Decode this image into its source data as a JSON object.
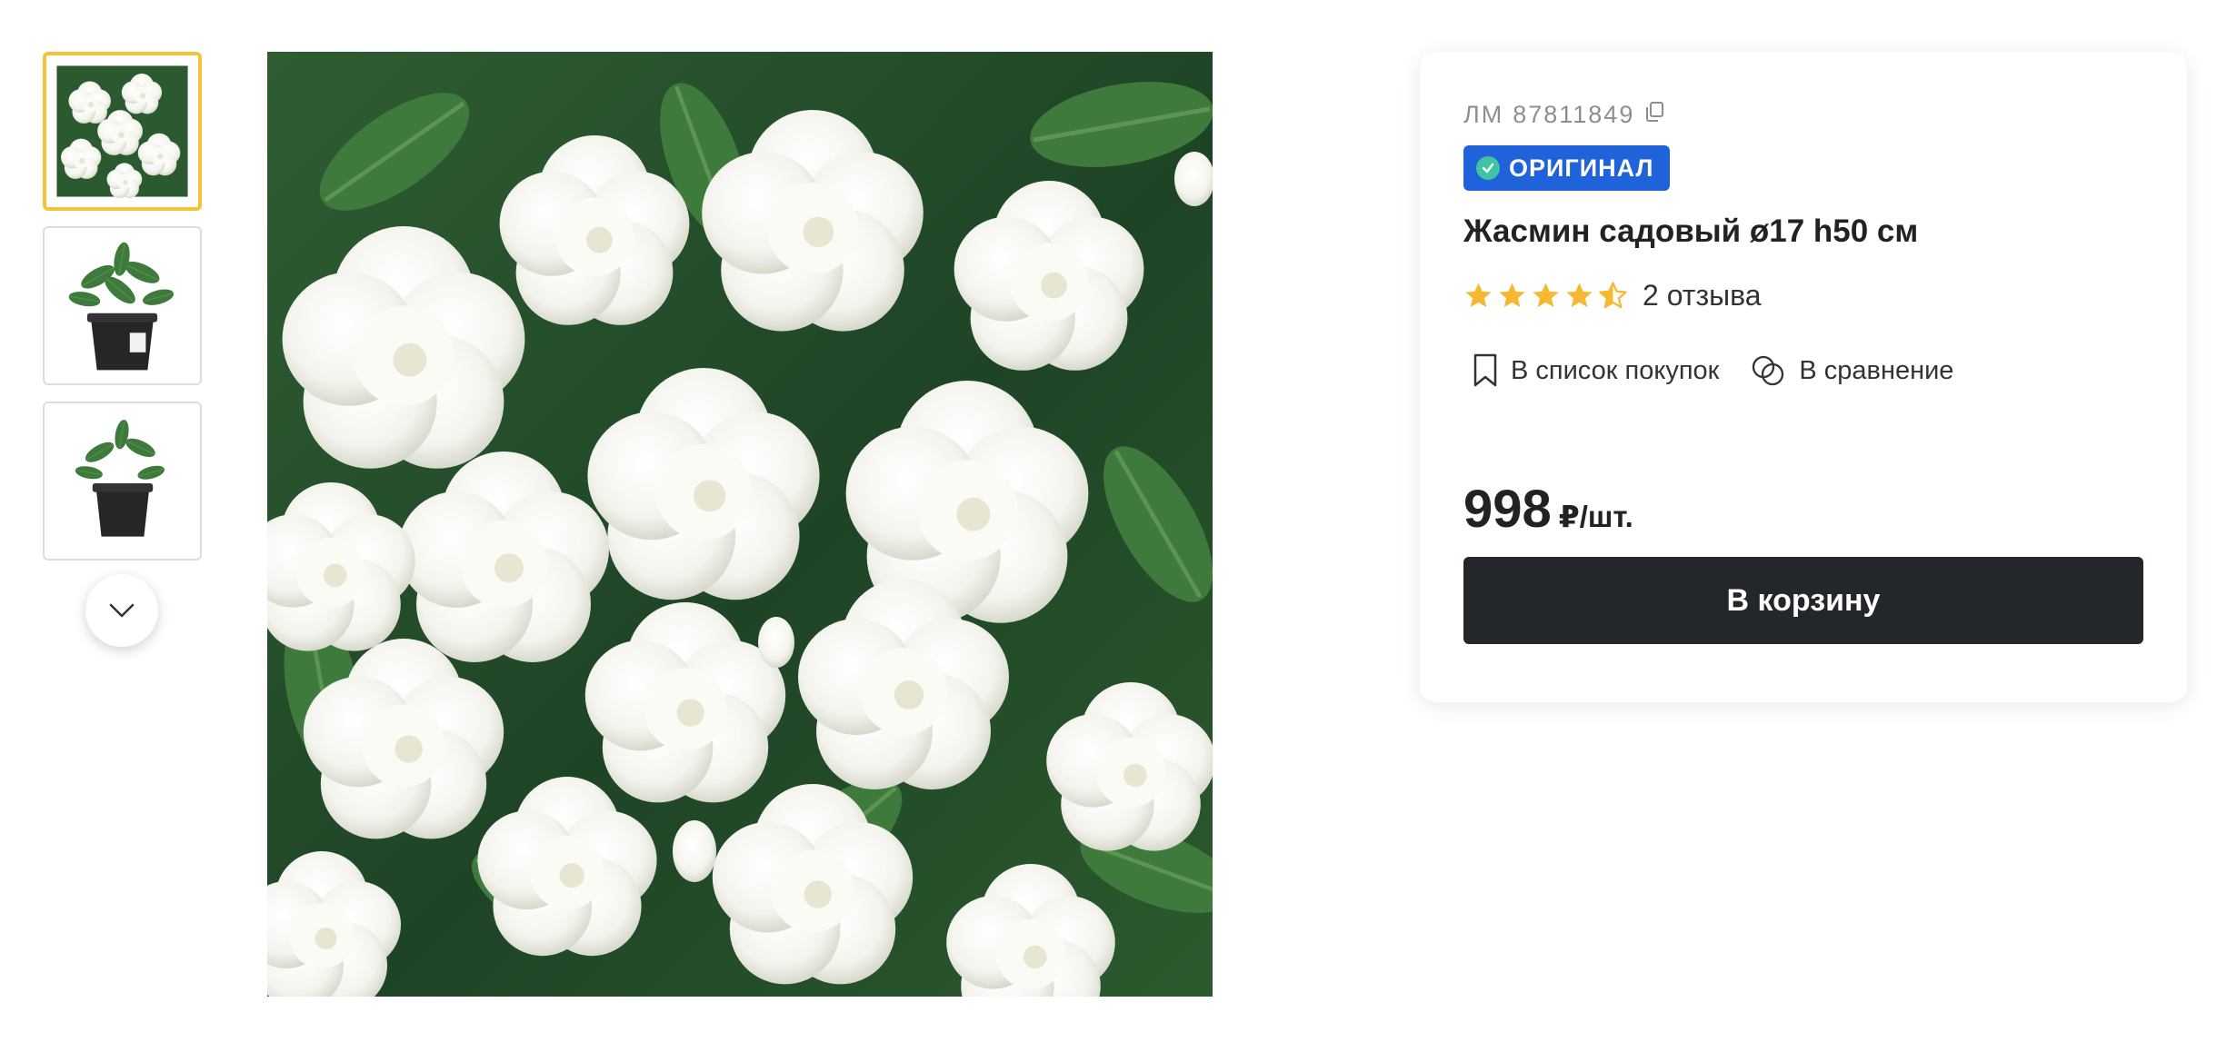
{
  "gallery": {
    "thumbnails": [
      {
        "alt": "flowers-closeup",
        "selected": true
      },
      {
        "alt": "potted-plant-front",
        "selected": false
      },
      {
        "alt": "potted-plant-side",
        "selected": false
      }
    ],
    "next_icon": "chevron-down-icon",
    "main_image": "white-jasmine-flowers"
  },
  "product": {
    "sku_prefix": "ЛМ",
    "sku": "87811849",
    "copy_icon": "copy-icon",
    "badge": "ОРИГИНАЛ",
    "title": "Жасмин садовый ø17 h50 см",
    "rating": 4.5,
    "reviews_label": "2 отзыва",
    "shopping_list_label": "В список покупок",
    "compare_label": "В сравнение",
    "price": "998",
    "price_unit": "₽/шт.",
    "cart_button": "В корзину"
  },
  "colors": {
    "badge_bg": "#1f62d9",
    "star": "#f5b82e",
    "cart_bg": "#23272b",
    "thumb_selected": "#f3c437"
  }
}
